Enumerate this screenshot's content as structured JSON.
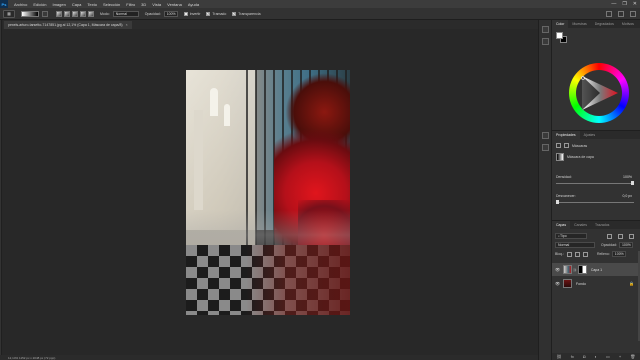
{
  "menubar": {
    "app_logo": "Ps",
    "items": [
      "Archivo",
      "Edición",
      "Imagen",
      "Capa",
      "Texto",
      "Selección",
      "Filtro",
      "3D",
      "Vista",
      "Ventana",
      "Ayuda"
    ],
    "window_controls": [
      "—",
      "❐",
      "✕"
    ]
  },
  "options": {
    "modo_label": "Modo:",
    "modo_value": "Normal",
    "opacidad_label": "Opacidad:",
    "opacidad_value": "100%",
    "invertir_label": "Invertir",
    "tramado_label": "Tramado",
    "transparencia_label": "Transparencia"
  },
  "document": {
    "tab_title": "pexels-arturo-tarsetto-7147851.jpg al 12,1% (Capa 1, Máscara de capa/8)",
    "tab_close": "×"
  },
  "status": {
    "text": "12,14%    1152 px x 2048 px (72 ppp)"
  },
  "color_panel": {
    "tabs": [
      "Color",
      "Muestras",
      "Degradados",
      "Motivos"
    ],
    "fg_color": "#ffffff",
    "bg_color": "#000000"
  },
  "properties_panel": {
    "tabs": [
      "Propiedades",
      "Ajustes"
    ],
    "mask_type": "Máscaras",
    "mask_label": "Máscara de capa",
    "densidad_label": "Densidad:",
    "densidad_value": "100%",
    "densidad_fraction": 1.0,
    "desvanecer_label": "Desvanecer:",
    "desvanecer_value": "0,0 px",
    "desvanecer_fraction": 0.0
  },
  "layers_panel": {
    "tabs": [
      "Capas",
      "Canales",
      "Trazados"
    ],
    "filter_value": "Tipo",
    "blend_mode": "Normal",
    "opacity_label": "Opacidad:",
    "opacity_value": "100%",
    "lock_label": "Bloq.:",
    "fill_label": "Relleno:",
    "fill_value": "100%",
    "layers": [
      {
        "name": "Capa 1",
        "selected": true,
        "has_mask": true
      },
      {
        "name": "Fondo",
        "selected": false,
        "has_mask": false
      }
    ],
    "bottom_icons": [
      "link-icon",
      "fx-icon",
      "mask-icon",
      "adjustment-icon",
      "folder-icon",
      "new-layer-icon",
      "trash-icon"
    ],
    "bottom_glyphs": [
      "⛓",
      "fx",
      "◘",
      "◐",
      "▭",
      "+",
      "🗑"
    ]
  }
}
